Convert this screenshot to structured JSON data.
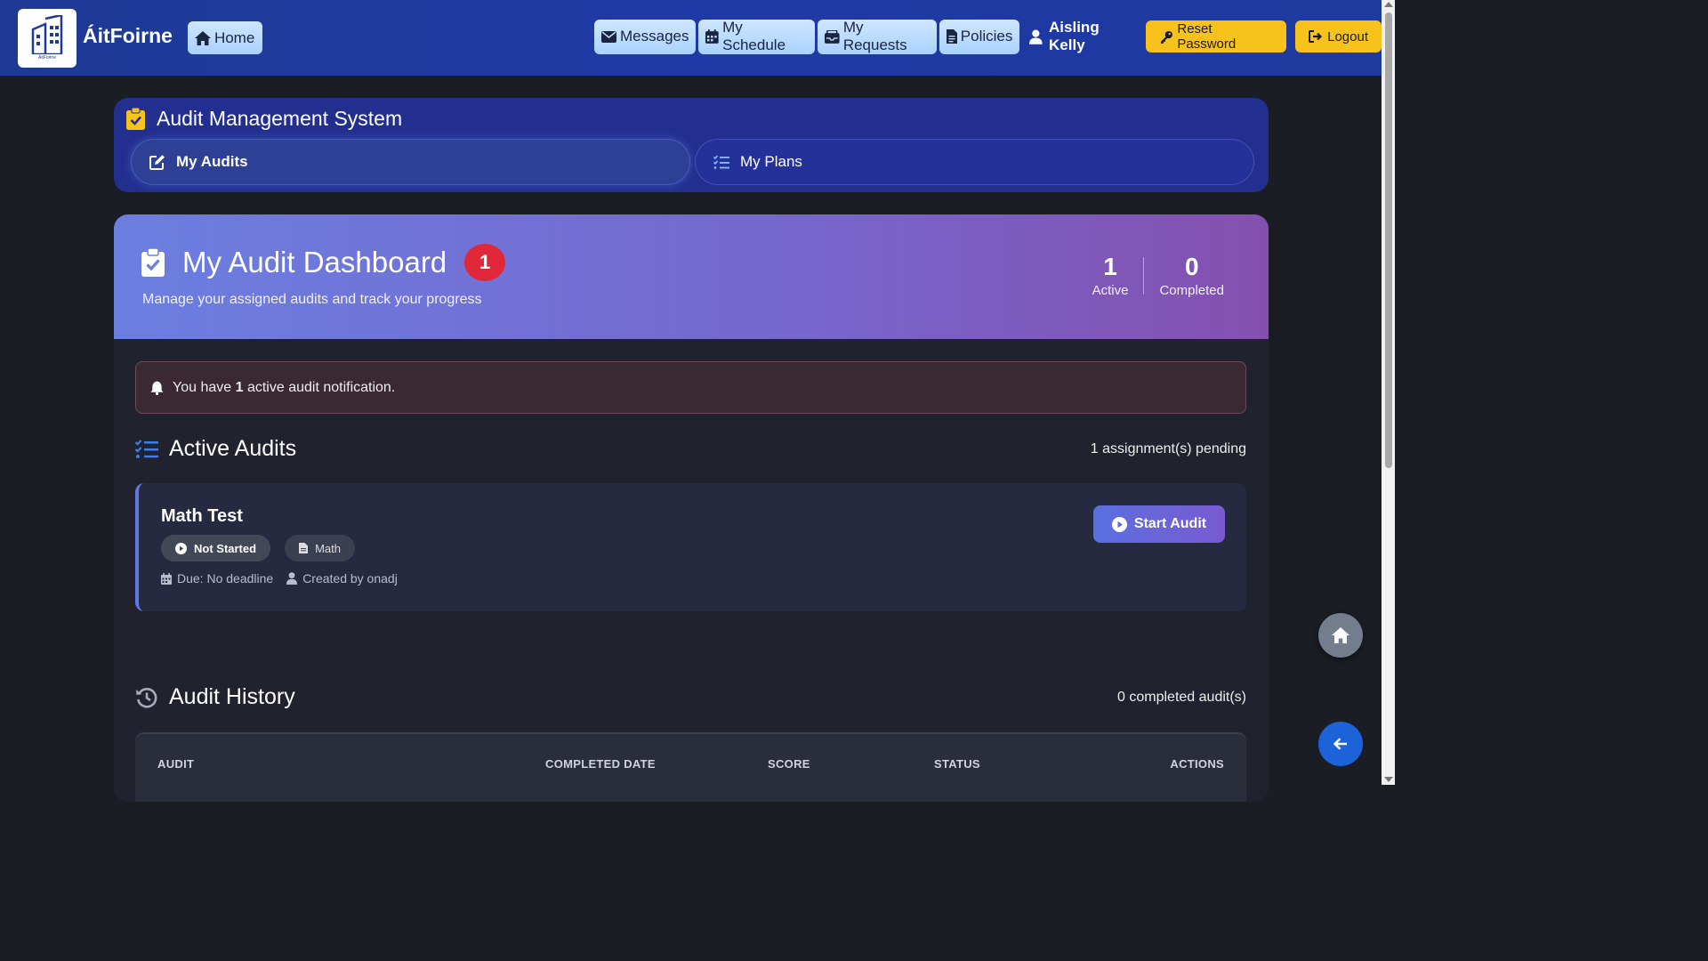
{
  "brand": {
    "name": "ÁitFoirne",
    "logo_caption": "ÁitFoirne"
  },
  "nav": {
    "home": "Home",
    "messages": "Messages",
    "schedule": "My Schedule",
    "requests": "My Requests",
    "policies": "Policies",
    "user_name": "Aisling Kelly",
    "reset_password": "Reset Password",
    "logout": "Logout"
  },
  "ams": {
    "title": "Audit Management System",
    "tabs": [
      {
        "label": "My Audits"
      },
      {
        "label": "My Plans"
      }
    ]
  },
  "dashboard": {
    "title": "My Audit Dashboard",
    "badge": "1",
    "subtitle": "Manage your assigned audits and track your progress",
    "stats": [
      {
        "value": "1",
        "label": "Active"
      },
      {
        "value": "0",
        "label": "Completed"
      }
    ]
  },
  "notification": {
    "prefix": "You have ",
    "count": "1",
    "suffix": " active audit notification."
  },
  "active_audits": {
    "heading": "Active Audits",
    "pending": "1 assignment(s) pending",
    "items": [
      {
        "name": "Math Test",
        "status": "Not Started",
        "subject": "Math",
        "due": "Due: No deadline",
        "created_by": "Created by onadj",
        "action": "Start Audit"
      }
    ]
  },
  "history": {
    "heading": "Audit History",
    "count": "0 completed audit(s)",
    "columns": [
      "AUDIT",
      "COMPLETED DATE",
      "SCORE",
      "STATUS",
      "ACTIONS"
    ]
  },
  "colors": {
    "navbar": "#1f3aa6",
    "accent_yellow": "#f8c21c",
    "badge_red": "#e0283a",
    "fab_blue": "#1c62d9"
  }
}
